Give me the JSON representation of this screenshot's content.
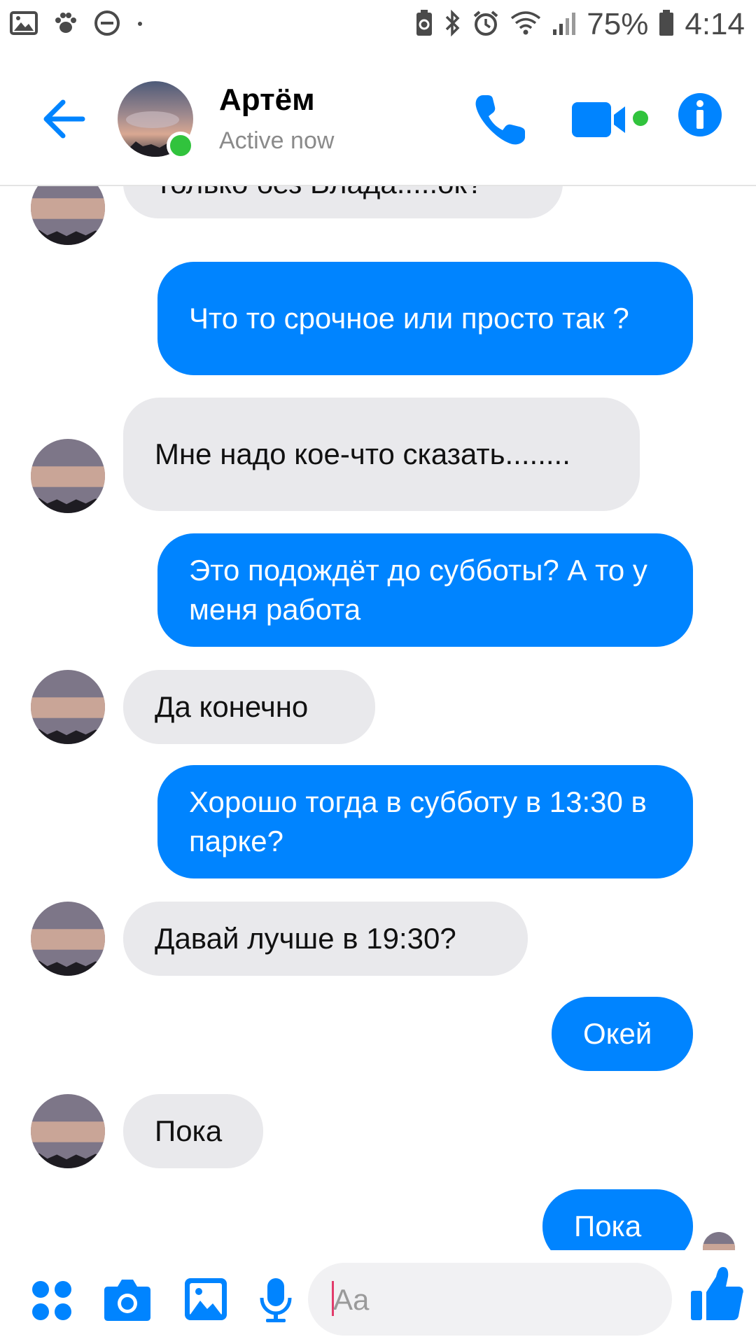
{
  "status_bar": {
    "battery_percent": "75%",
    "time": "4:14",
    "left_icons": [
      "gallery-icon",
      "paw-icon",
      "do-not-disturb-icon",
      "dot-icon"
    ],
    "right_icons": [
      "battery-saver-icon",
      "bluetooth-icon",
      "alarm-icon",
      "wifi-icon",
      "signal-icon",
      "battery-icon"
    ]
  },
  "header": {
    "contact_name": "Артём",
    "contact_status": "Active now"
  },
  "messages": [
    {
      "direction": "in",
      "text": "Только без Влада.....ок?"
    },
    {
      "direction": "out",
      "text": "Что то срочное или просто так ?"
    },
    {
      "direction": "in",
      "text": "Мне надо кое-что сказать........"
    },
    {
      "direction": "out",
      "text": "Это подождёт до субботы? А то у меня работа"
    },
    {
      "direction": "in",
      "text": "Да конечно"
    },
    {
      "direction": "out",
      "text": "Хорошо тогда в субботу в 13:30 в парке?"
    },
    {
      "direction": "in",
      "text": "Давай лучше в 19:30?"
    },
    {
      "direction": "out",
      "text": "Окей"
    },
    {
      "direction": "in",
      "text": "Пока"
    },
    {
      "direction": "out",
      "text": "Пока"
    }
  ],
  "composer": {
    "placeholder": "Aa",
    "value": ""
  },
  "colors": {
    "accent": "#0084ff",
    "incoming_bubble": "#e9e9ec",
    "presence": "#31c33d"
  }
}
